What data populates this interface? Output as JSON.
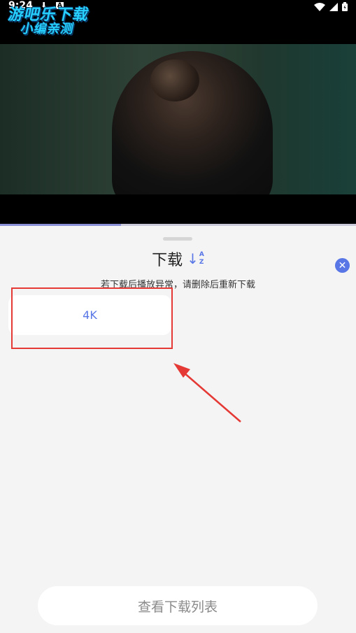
{
  "status_bar": {
    "time": "9:24",
    "download_icon": "download-arrow-icon",
    "a_icon": "A",
    "wifi_icon": "wifi-icon",
    "signal_icon": "signal-icon",
    "battery_icon": "battery-icon"
  },
  "watermark": {
    "line1": "游吧乐下载",
    "line2": "小编亲测"
  },
  "player": {
    "progress_fraction": 0.34
  },
  "sheet": {
    "title": "下载",
    "sort_icon": "sort-az-icon",
    "sort_letters": [
      "A",
      "Z"
    ],
    "close_icon": "close-icon",
    "notice": "若下载后播放异常，请删除后重新下载",
    "options": [
      {
        "label": "4K"
      }
    ],
    "view_list_button": "查看下载列表"
  },
  "annotation": {
    "highlight_color": "#e53935"
  },
  "colors": {
    "accent": "#5876e6",
    "background": "#f4f4f4"
  }
}
